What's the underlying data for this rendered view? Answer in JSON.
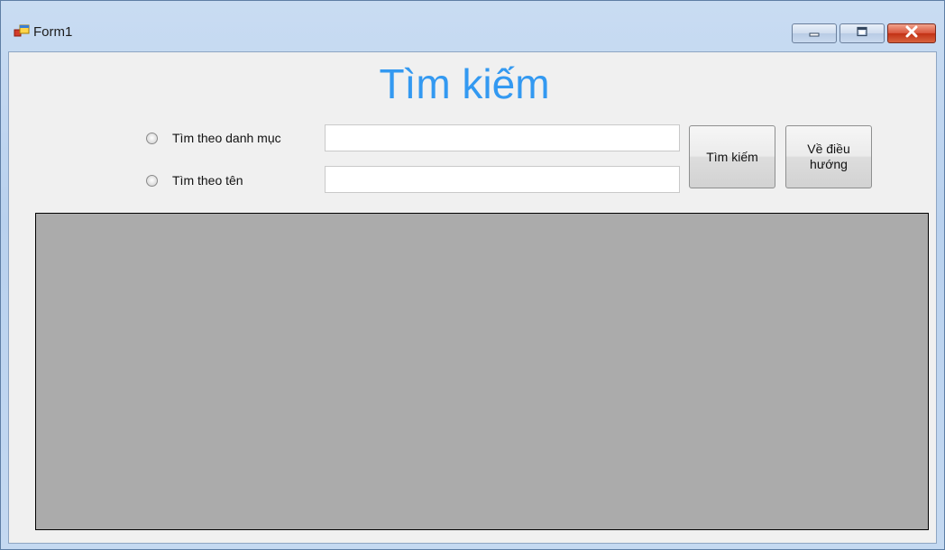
{
  "window": {
    "title": "Form1",
    "icon": "winforms-form-icon",
    "controls": {
      "minimize": "minimize-icon",
      "maximize": "maximize-icon",
      "close": "close-icon"
    }
  },
  "form": {
    "heading": "Tìm kiếm",
    "options": [
      {
        "label": "Tìm theo danh mục",
        "selected": false
      },
      {
        "label": "Tìm theo tên",
        "selected": false
      }
    ],
    "inputs": [
      {
        "value": ""
      },
      {
        "value": ""
      }
    ],
    "buttons": {
      "search": "Tìm kiếm",
      "back": "Về điều hướng"
    }
  },
  "colors": {
    "heading": "#3399f1",
    "grid_background": "#ababab"
  }
}
